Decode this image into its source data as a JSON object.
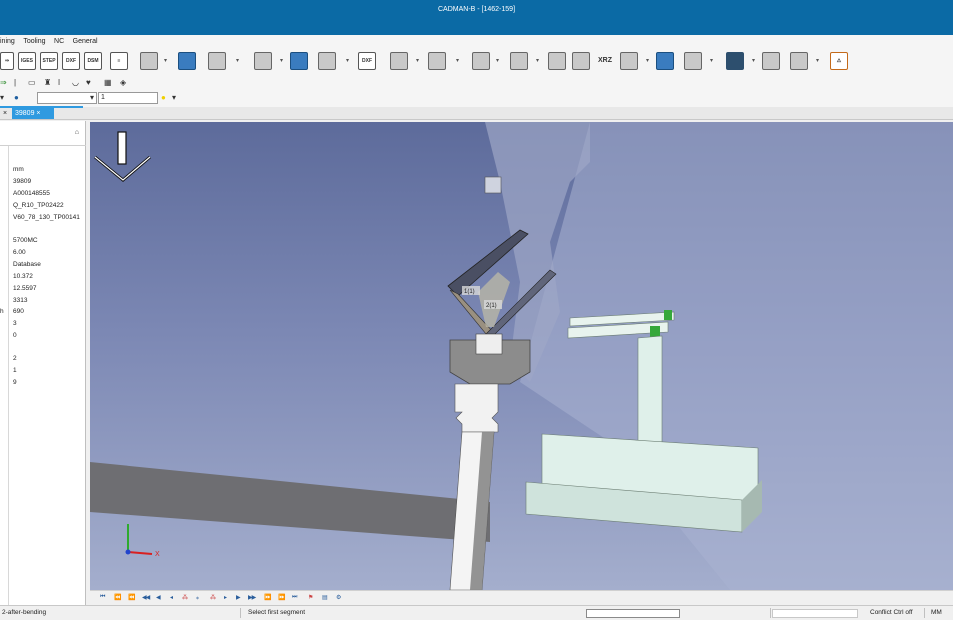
{
  "window": {
    "title": "CADMAN-B - [1462-159]"
  },
  "menu": [
    "ining",
    "Tooling",
    "NC",
    "General"
  ],
  "toolbar1": {
    "file_icons": [
      "IGES",
      "STEP",
      "DXF",
      "DSM"
    ],
    "dxf_label": "DXF",
    "xrz_label": "XRZ"
  },
  "toolbar3": {
    "combo_value": "",
    "field_value": "1"
  },
  "tabs": [
    {
      "label": "×",
      "active": false
    },
    {
      "label": "39809",
      "active": true
    }
  ],
  "properties": {
    "label_h": "h",
    "values": [
      "mm",
      "39809",
      "A000148555",
      "Q_R10_TP02422",
      "V60_78_130_TP00141",
      "5700MC",
      "6.00",
      "Database",
      "10.372",
      "12.5597",
      "3313",
      "690",
      "3",
      "0",
      "2",
      "1",
      "9"
    ]
  },
  "viewport": {
    "label_1": "1(1)",
    "label_2": "2(1)",
    "axis_x": "X"
  },
  "status": {
    "left": "2-after-bending",
    "middle": "Select first segment",
    "conflict": "Conflict Ctrl off",
    "unit": "MM"
  }
}
